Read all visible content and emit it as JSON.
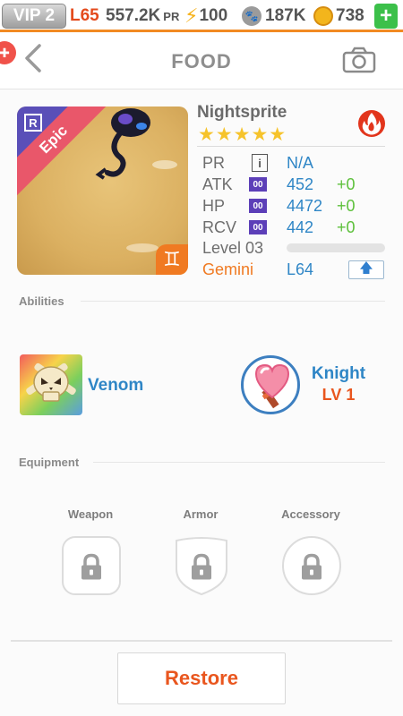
{
  "statusbar": {
    "vip": "VIP 2",
    "level": "L65",
    "pr_value": "557.2K",
    "pr_unit": "PR",
    "energy": "100",
    "paw": "187K",
    "coins": "738",
    "plus": "+"
  },
  "nav": {
    "title": "FOOD",
    "back_icon": "chevron-left-icon",
    "camera_icon": "camera-icon"
  },
  "monster": {
    "name": "Nightsprite",
    "rarity": "Epic",
    "rarity_badge": "R",
    "stars": "★★★★★",
    "star_count": 5,
    "element_icon": "fire-icon",
    "zodiac_icon": "gemini-icon",
    "zodiac_symbol": "♊",
    "stats": [
      {
        "label": "PR",
        "badge": "i",
        "value": "N/A",
        "bonus": ""
      },
      {
        "label": "ATK",
        "badge": "00",
        "value": "452",
        "bonus": "+0"
      },
      {
        "label": "HP",
        "badge": "00",
        "value": "4472",
        "bonus": "+0"
      },
      {
        "label": "RCV",
        "badge": "00",
        "value": "442",
        "bonus": "+0"
      }
    ],
    "level": "Level 03",
    "xp_fraction": 0.0,
    "sign": "Gemini",
    "sign_level": "L64",
    "upgrade_icon": "arrow-up-icon",
    "upgrade_glyph": "🡅"
  },
  "abilities": {
    "heading": "Abilities",
    "items": [
      {
        "name": "Venom",
        "icon": "skull-icon"
      },
      {
        "name": "Knight",
        "level": "LV 1",
        "icon": "shield-heart-icon"
      }
    ]
  },
  "equipment": {
    "heading": "Equipment",
    "slots": [
      {
        "label": "Weapon",
        "icon": "lock-icon"
      },
      {
        "label": "Armor",
        "icon": "lock-icon"
      },
      {
        "label": "Accessory",
        "icon": "lock-icon"
      }
    ]
  },
  "actions": {
    "restore": "Restore"
  },
  "colors": {
    "accent_orange": "#f07a22",
    "blue_value": "#2f86c6",
    "green_bonus": "#5dc03b",
    "restore_red": "#e9561e"
  }
}
